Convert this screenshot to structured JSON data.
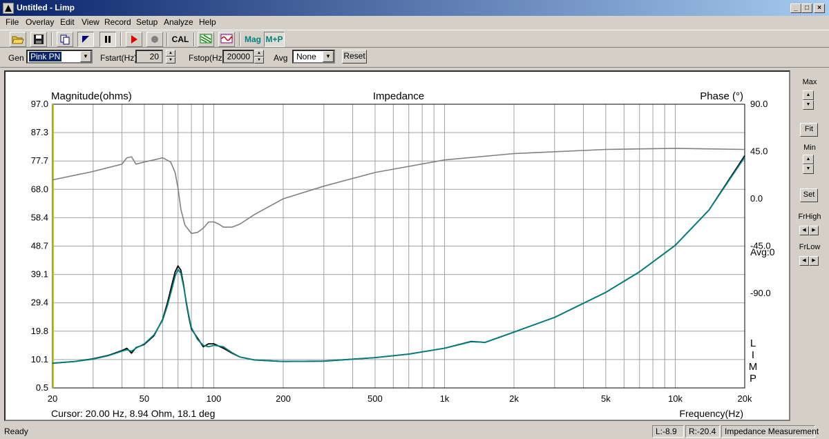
{
  "window": {
    "title": "Untitled - Limp"
  },
  "menu": [
    "File",
    "Overlay",
    "Edit",
    "View",
    "Record",
    "Setup",
    "Analyze",
    "Help"
  ],
  "toolbar": {
    "cal_label": "CAL",
    "mag_label": "Mag",
    "mp_label": "M+P"
  },
  "controls": {
    "gen_label": "Gen",
    "gen_value": "Pink PN",
    "fstart_label": "Fstart(Hz)",
    "fstart_value": "20",
    "fstop_label": "Fstop(Hz)",
    "fstop_value": "20000",
    "avg_label": "Avg",
    "avg_value": "None",
    "reset_label": "Reset"
  },
  "side_panel": {
    "max_label": "Max",
    "fit_label": "Fit",
    "min_label": "Min",
    "set_label": "Set",
    "frhigh_label": "FrHigh",
    "frlow_label": "FrLow"
  },
  "status": {
    "ready": "Ready",
    "left": "L:-8.9",
    "right": "R:-20.4",
    "mode": "Impedance Measurement"
  },
  "colors": {
    "magnitude_main": "#008080",
    "magnitude_overlay": "#000000",
    "phase": "#808080",
    "cursor": "#c8c800"
  },
  "chart_data": {
    "type": "line",
    "title": "Impedance",
    "ylabel": "Magnitude(ohms)",
    "y2label": "Phase (°)",
    "xlabel": "Frequency(Hz)",
    "x_scale": "log",
    "xlim": [
      20,
      20000
    ],
    "ylim": [
      0.5,
      97.0
    ],
    "y2lim": [
      -180,
      90
    ],
    "x_ticks": [
      20,
      50,
      100,
      200,
      500,
      1000,
      2000,
      5000,
      10000,
      20000
    ],
    "x_tick_labels": [
      "20",
      "50",
      "100",
      "200",
      "500",
      "1k",
      "2k",
      "5k",
      "10k",
      "20k"
    ],
    "y_ticks": [
      "97.0",
      "87.3",
      "77.7",
      "68.0",
      "58.4",
      "48.7",
      "39.1",
      "29.4",
      "19.8",
      "10.1",
      "0.5"
    ],
    "y2_ticks": [
      "90.0",
      "45.0",
      "0.0",
      "-45.0",
      "-90.0"
    ],
    "avg_label": "Avg:0",
    "side_text": [
      "L",
      "I",
      "M",
      "P"
    ],
    "cursor_readout": "Cursor: 20.00 Hz, 8.94 Ohm, 18.1 deg",
    "grid": true,
    "series": [
      {
        "role": "magnitude",
        "x": [
          20,
          25,
          30,
          35,
          40,
          42,
          44,
          46,
          50,
          55,
          60,
          63,
          66,
          68,
          70,
          72,
          74,
          76,
          78,
          80,
          85,
          90,
          95,
          100,
          110,
          120,
          130,
          150,
          200,
          300,
          500,
          700,
          1000,
          1200,
          1300,
          1500,
          2000,
          3000,
          5000,
          7000,
          10000,
          14000,
          20000
        ],
        "y": [
          8.9,
          9.5,
          10.3,
          11.5,
          13.0,
          13.5,
          13.0,
          14.0,
          15.5,
          18.5,
          23.5,
          28.5,
          34.5,
          38.5,
          40.8,
          39.5,
          35.0,
          30.0,
          25.0,
          21.0,
          17.0,
          15.0,
          14.5,
          15.0,
          14.5,
          12.5,
          11.0,
          10.0,
          9.5,
          9.6,
          10.8,
          12.0,
          14.0,
          15.5,
          16.2,
          16.0,
          19.5,
          24.5,
          33.0,
          40.0,
          49.0,
          61.0,
          79.0
        ]
      },
      {
        "role": "magnitude_overlay",
        "x": [
          20,
          25,
          30,
          35,
          40,
          42,
          44,
          46,
          50,
          55,
          60,
          63,
          66,
          68,
          70,
          72,
          74,
          76,
          78,
          80,
          85,
          90,
          95,
          100,
          110,
          120,
          130,
          150,
          200,
          300,
          500,
          700,
          1000,
          1200,
          1300,
          1500,
          2000,
          3000,
          5000,
          7000,
          10000,
          14000,
          20000
        ],
        "y": [
          8.9,
          9.5,
          10.4,
          11.6,
          13.2,
          14.0,
          12.3,
          14.2,
          15.3,
          18.2,
          23.8,
          29.5,
          36.0,
          40.0,
          42.0,
          40.5,
          35.5,
          29.5,
          24.5,
          20.5,
          17.5,
          14.5,
          15.5,
          15.5,
          14.0,
          12.3,
          11.0,
          10.0,
          9.5,
          9.6,
          10.8,
          12.0,
          14.0,
          15.6,
          16.3,
          16.0,
          19.5,
          24.5,
          33.0,
          40.0,
          49.0,
          61.0,
          79.5
        ]
      },
      {
        "role": "phase",
        "x": [
          20,
          30,
          40,
          42,
          44,
          46,
          50,
          55,
          60,
          65,
          68,
          70,
          72,
          75,
          80,
          85,
          90,
          95,
          100,
          105,
          110,
          120,
          130,
          150,
          200,
          300,
          500,
          1000,
          2000,
          5000,
          10000,
          20000
        ],
        "y": [
          18.0,
          26.0,
          33.0,
          39.0,
          40.0,
          33.0,
          35.0,
          37.0,
          39.0,
          35.0,
          25.0,
          10.0,
          -10.0,
          -25.0,
          -33.0,
          -32.0,
          -28.0,
          -22.0,
          -22.0,
          -24.0,
          -27.0,
          -27.0,
          -24.0,
          -15.0,
          0.0,
          12.0,
          25.0,
          37.0,
          43.0,
          47.0,
          48.0,
          47.0
        ]
      }
    ]
  }
}
